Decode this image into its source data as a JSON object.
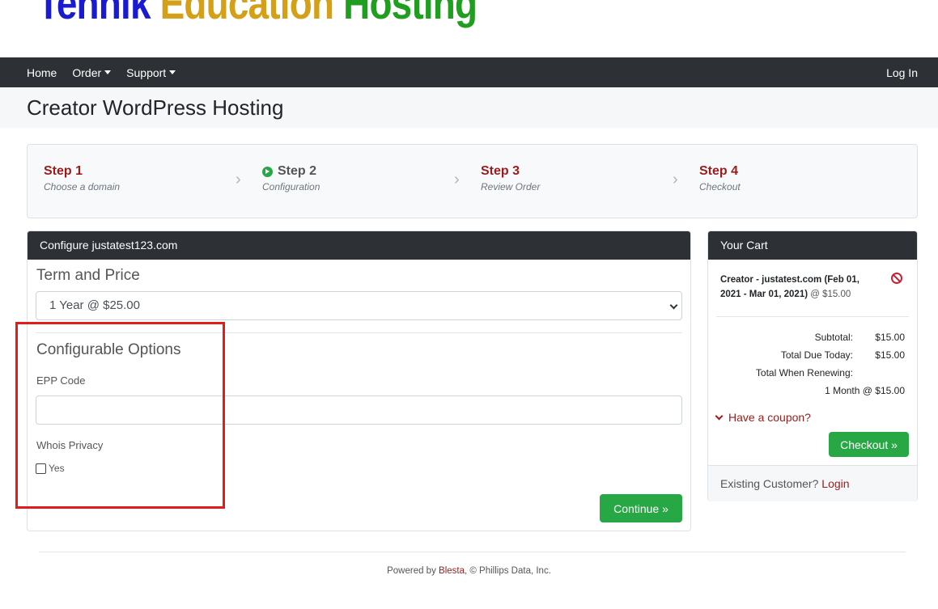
{
  "logo": {
    "part1": "Tennik",
    "part2": " Education",
    "part3": " Hosting"
  },
  "nav": {
    "home": "Home",
    "order": "Order",
    "support": "Support",
    "login": "Log In"
  },
  "page": {
    "title": "Creator WordPress Hosting"
  },
  "steps": [
    {
      "title": "Step 1",
      "subtitle": "Choose a domain"
    },
    {
      "title": "Step 2",
      "subtitle": "Configuration"
    },
    {
      "title": "Step 3",
      "subtitle": "Review Order"
    },
    {
      "title": "Step 4",
      "subtitle": "Checkout"
    }
  ],
  "config": {
    "header": "Configure justatest123.com",
    "term_title": "Term and Price",
    "term_value": "1 Year @ $25.00",
    "options_title": "Configurable Options",
    "epp_label": "EPP Code",
    "epp_value": "",
    "whois_label": "Whois Privacy",
    "whois_option": "Yes",
    "continue_label": "Continue »"
  },
  "cart": {
    "header": "Your Cart",
    "item_name": "Creator - justatest.com (Feb 01, 2021 - Mar 01, 2021)",
    "item_price": " @ $15.00",
    "subtotal_label": "Subtotal:",
    "subtotal_value": "$15.00",
    "due_label": "Total Due Today:",
    "due_value": "$15.00",
    "renew_label": "Total When Renewing:",
    "renew_value": "1 Month @ $15.00",
    "coupon_label": "Have a coupon?",
    "checkout_label": "Checkout »",
    "existing_text": "Existing Customer? ",
    "login_link": "Login"
  },
  "footer": {
    "prefix": "Powered by ",
    "link": "Blesta",
    "suffix": ", © Phillips Data, Inc."
  },
  "colors": {
    "accent_red": "#9b1b1b",
    "button_green": "#28a745",
    "navbar": "#2d3035",
    "highlight": "#e31b1b"
  }
}
